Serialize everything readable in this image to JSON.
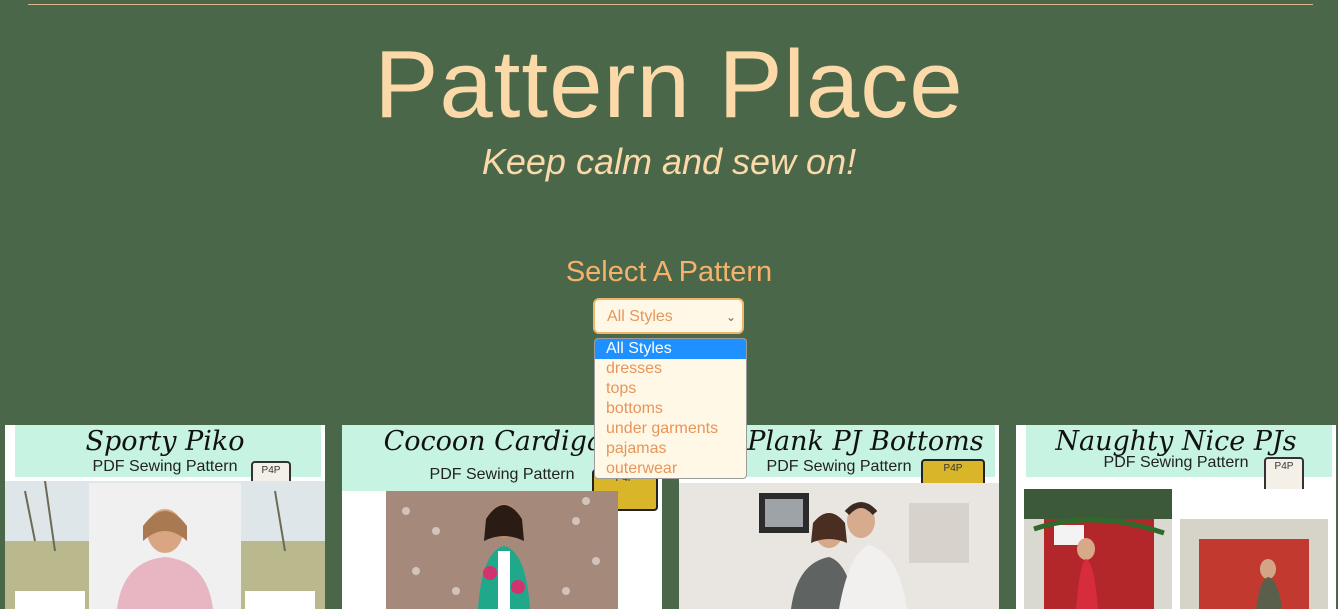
{
  "header": {
    "title": "Pattern Place",
    "tagline": "Keep calm and sew on!"
  },
  "filter": {
    "heading": "Select A Pattern",
    "selected": "All Styles",
    "options": [
      "All Styles",
      "dresses",
      "tops",
      "bottoms",
      "under garments",
      "pajamas",
      "outerwear"
    ]
  },
  "patterns": [
    {
      "name": "Sporty Piko",
      "subtitle": "PDF Sewing Pattern"
    },
    {
      "name": "Cocoon Cardigan",
      "subtitle": "PDF Sewing Pattern"
    },
    {
      "name": "the Plank PJ Bottoms",
      "subtitle": "PDF Sewing Pattern"
    },
    {
      "name": "Naughty Nice PJs",
      "subtitle": "PDF Sewing Pattern"
    }
  ],
  "badge_text": "P4P",
  "colors": {
    "background": "#4a6849",
    "title": "#fcd9a8",
    "accent": "#f6b26b",
    "selected_option": "#1e90ff"
  }
}
